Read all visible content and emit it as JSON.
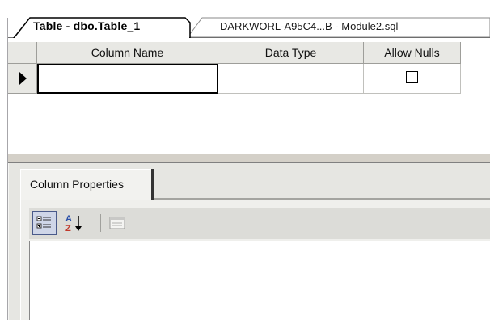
{
  "tabs": [
    {
      "label": "Table - dbo.Table_1",
      "active": true
    },
    {
      "label": "DARKWORL-A95C4...B - Module2.sql",
      "active": false
    }
  ],
  "grid": {
    "columns": [
      "Column Name",
      "Data Type",
      "Allow Nulls"
    ],
    "rows": [
      {
        "column_name": "",
        "data_type": "",
        "allow_nulls": false
      }
    ]
  },
  "properties": {
    "tab_label": "Column Properties",
    "toolbar": [
      {
        "name": "categorized-icon"
      },
      {
        "name": "alphabetical-sort-icon"
      },
      {
        "name": "property-pages-icon"
      }
    ]
  },
  "colors": {
    "panel": "#e6e6e2",
    "header": "#e8e8e4",
    "active_tab": "#ffffff"
  }
}
